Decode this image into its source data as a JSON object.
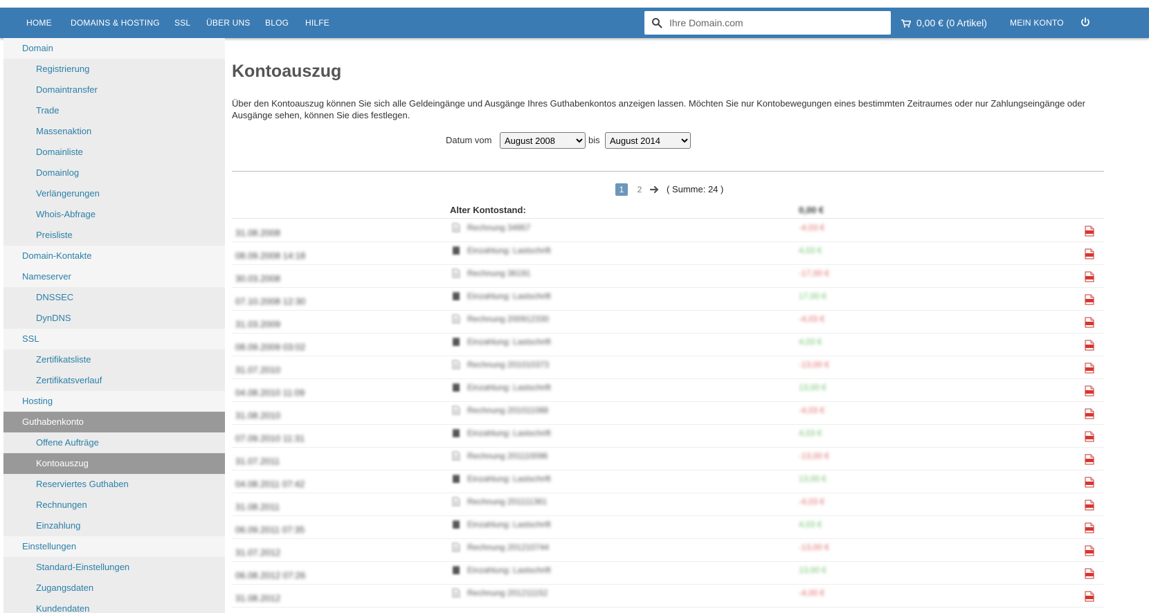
{
  "nav": {
    "items": [
      "HOME",
      "DOMAINS & HOSTING",
      "SSL",
      "ÜBER UNS",
      "BLOG",
      "HILFE"
    ],
    "search_placeholder": "Ihre Domain.com",
    "cart": "0,00 € (0 Artikel)",
    "account": "MEIN KONTO"
  },
  "sidebar": {
    "items": [
      {
        "label": "Domain",
        "level": 1
      },
      {
        "label": "Registrierung",
        "level": 2
      },
      {
        "label": "Domaintransfer",
        "level": 2
      },
      {
        "label": "Trade",
        "level": 2
      },
      {
        "label": "Massenaktion",
        "level": 2
      },
      {
        "label": "Domainliste",
        "level": 2
      },
      {
        "label": "Domainlog",
        "level": 2
      },
      {
        "label": "Verlängerungen",
        "level": 2
      },
      {
        "label": "Whois-Abfrage",
        "level": 2
      },
      {
        "label": "Preisliste",
        "level": 2
      },
      {
        "label": "Domain-Kontakte",
        "level": 1
      },
      {
        "label": "Nameserver",
        "level": 1
      },
      {
        "label": "DNSSEC",
        "level": 2
      },
      {
        "label": "DynDNS",
        "level": 2
      },
      {
        "label": "SSL",
        "level": 1
      },
      {
        "label": "Zertifikatsliste",
        "level": 2
      },
      {
        "label": "Zertifikatsverlauf",
        "level": 2
      },
      {
        "label": "Hosting",
        "level": 1
      },
      {
        "label": "Guthabenkonto",
        "level": 1,
        "active": true
      },
      {
        "label": "Offene Aufträge",
        "level": 2
      },
      {
        "label": "Kontoauszug",
        "level": 2,
        "active": true
      },
      {
        "label": "Reserviertes Guthaben",
        "level": 2
      },
      {
        "label": "Rechnungen",
        "level": 2
      },
      {
        "label": "Einzahlung",
        "level": 2
      },
      {
        "label": "Einstellungen",
        "level": 1
      },
      {
        "label": "Standard-Einstellungen",
        "level": 2
      },
      {
        "label": "Zugangsdaten",
        "level": 2
      },
      {
        "label": "Kundendaten",
        "level": 2
      }
    ]
  },
  "main": {
    "title": "Kontoauszug",
    "intro": "Über den Kontoauszug können Sie sich alle Geldeingänge und Ausgänge Ihres Guthabenkontos anzeigen lassen. Möchten Sie nur Kontobewegungen eines bestimmten Zeitraumes oder nur Zahlungseingänge oder Ausgänge sehen, können Sie dies festlegen.",
    "filter": {
      "from_label": "Datum vom",
      "from_value": "August 2008",
      "to_label": "bis",
      "to_value": "August 2014"
    },
    "pagination": {
      "pages": [
        "1",
        "2"
      ],
      "current": "1",
      "summary": "( Summe: 24 )"
    },
    "table": {
      "old_balance_label": "Alter Kontostand:",
      "old_balance_value": "0,00 €",
      "rows": [
        {
          "date": "31.08.2008",
          "text": "Rechnung 34957",
          "amount": "-4,03 €",
          "type": "invoice"
        },
        {
          "date": "08.09.2008 14:18",
          "text": "Einzahlung: Lastschrift",
          "amount": "4,03 €",
          "type": "payment"
        },
        {
          "date": "30.03.2008",
          "text": "Rechnung 36191",
          "amount": "-17,00 €",
          "type": "invoice"
        },
        {
          "date": "07.10.2008 12:30",
          "text": "Einzahlung: Lastschrift",
          "amount": "17,00 €",
          "type": "payment"
        },
        {
          "date": "31.03.2009",
          "text": "Rechnung 200912330",
          "amount": "-4,03 €",
          "type": "invoice"
        },
        {
          "date": "08.09.2009 03:02",
          "text": "Einzahlung: Lastschrift",
          "amount": "4,03 €",
          "type": "payment"
        },
        {
          "date": "31.07.2010",
          "text": "Rechnung 201010373",
          "amount": "-13,00 €",
          "type": "invoice"
        },
        {
          "date": "04.08.2010 11:09",
          "text": "Einzahlung: Lastschrift",
          "amount": "13,00 €",
          "type": "payment"
        },
        {
          "date": "31.08.2010",
          "text": "Rechnung 201011088",
          "amount": "-4,03 €",
          "type": "invoice"
        },
        {
          "date": "07.09.2010 11:31",
          "text": "Einzahlung: Lastschrift",
          "amount": "4,03 €",
          "type": "payment"
        },
        {
          "date": "31.07.2011",
          "text": "Rechnung 201110096",
          "amount": "-13,00 €",
          "type": "invoice"
        },
        {
          "date": "04.08.2011 07:42",
          "text": "Einzahlung: Lastschrift",
          "amount": "13,00 €",
          "type": "payment"
        },
        {
          "date": "31.08.2011",
          "text": "Rechnung 201111361",
          "amount": "-4,03 €",
          "type": "invoice"
        },
        {
          "date": "06.09.2011 07:35",
          "text": "Einzahlung: Lastschrift",
          "amount": "4,03 €",
          "type": "payment"
        },
        {
          "date": "31.07.2012",
          "text": "Rechnung 201210744",
          "amount": "-13,00 €",
          "type": "invoice"
        },
        {
          "date": "06.08.2012 07:26",
          "text": "Einzahlung: Lastschrift",
          "amount": "13,00 €",
          "type": "payment"
        },
        {
          "date": "31.08.2012",
          "text": "Rechnung 201211152",
          "amount": "-4,00 €",
          "type": "invoice"
        }
      ]
    }
  },
  "colors": {
    "navbar": "#3b7bb3",
    "link": "#2b7fa8",
    "active_bg": "#999999",
    "negative": "#e06666",
    "positive": "#6abf6a"
  },
  "icons": {
    "search": "search-icon",
    "cart": "cart-icon",
    "power": "power-icon",
    "pdf": "pdf-icon",
    "arrow": "arrow-right-icon"
  }
}
